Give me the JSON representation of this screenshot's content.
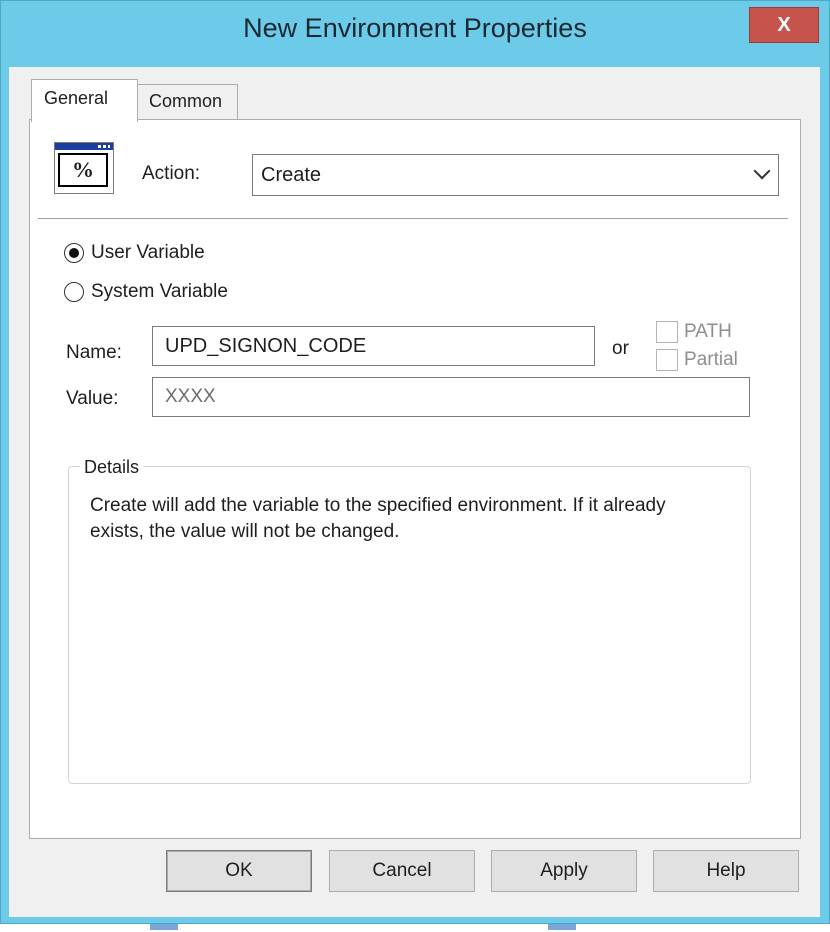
{
  "window": {
    "title": "New Environment Properties",
    "close_glyph": "X",
    "accent_color": "#6ccbe9",
    "close_color": "#c7544c"
  },
  "tabs": [
    {
      "label": "General",
      "selected": true
    },
    {
      "label": "Common",
      "selected": false
    }
  ],
  "general": {
    "icon_glyph": "%",
    "action_label": "Action:",
    "action_value": "Create",
    "radios": [
      {
        "label": "User Variable",
        "checked": true
      },
      {
        "label": "System Variable",
        "checked": false
      }
    ],
    "name_label": "Name:",
    "name_value": "UPD_SIGNON_CODE",
    "or_label": "or",
    "checkboxes": [
      {
        "label": "PATH",
        "checked": false,
        "enabled": false
      },
      {
        "label": "Partial",
        "checked": false,
        "enabled": false
      }
    ],
    "value_label": "Value:",
    "value_value": "XXXX",
    "details_title": "Details",
    "details_text": "Create will add the variable to the specified environment. If it already exists, the value will not be changed."
  },
  "buttons": {
    "ok": "OK",
    "cancel": "Cancel",
    "apply": "Apply",
    "help": "Help"
  }
}
